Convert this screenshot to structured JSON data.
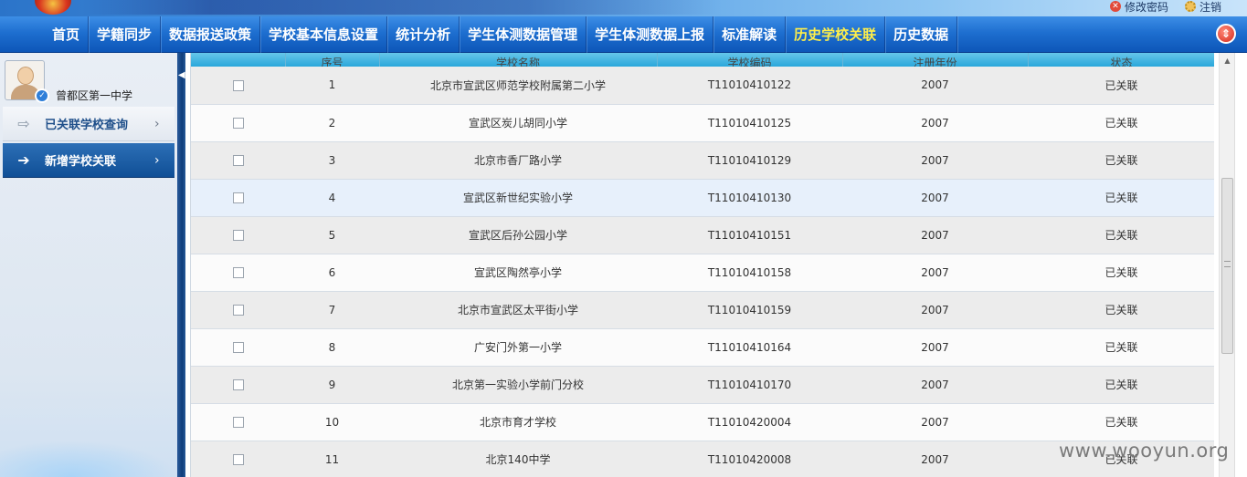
{
  "top_links": {
    "change_password": "修改密码",
    "logout": "注销"
  },
  "nav": {
    "items": [
      {
        "label": "首页"
      },
      {
        "label": "学籍同步"
      },
      {
        "label": "数据报送政策"
      },
      {
        "label": "学校基本信息设置"
      },
      {
        "label": "统计分析"
      },
      {
        "label": "学生体测数据管理"
      },
      {
        "label": "学生体测数据上报"
      },
      {
        "label": "标准解读"
      },
      {
        "label": "历史学校关联",
        "active": true
      },
      {
        "label": "历史数据"
      }
    ]
  },
  "sidebar": {
    "user_name": "曾都区第一中学",
    "items": [
      {
        "label": "已关联学校查询"
      },
      {
        "label": "新增学校关联",
        "active": true
      }
    ]
  },
  "table": {
    "columns": [
      "",
      "序号",
      "学校名称",
      "学校编码",
      "注册年份",
      "状态"
    ],
    "rows": [
      {
        "no": "1",
        "name": "北京市宣武区师范学校附属第二小学",
        "code": "T11010410122",
        "year": "2007",
        "status": "已关联"
      },
      {
        "no": "2",
        "name": "宣武区炭儿胡同小学",
        "code": "T11010410125",
        "year": "2007",
        "status": "已关联"
      },
      {
        "no": "3",
        "name": "北京市香厂路小学",
        "code": "T11010410129",
        "year": "2007",
        "status": "已关联"
      },
      {
        "no": "4",
        "name": "宣武区新世纪实验小学",
        "code": "T11010410130",
        "year": "2007",
        "status": "已关联"
      },
      {
        "no": "5",
        "name": "宣武区后孙公园小学",
        "code": "T11010410151",
        "year": "2007",
        "status": "已关联"
      },
      {
        "no": "6",
        "name": "宣武区陶然亭小学",
        "code": "T11010410158",
        "year": "2007",
        "status": "已关联"
      },
      {
        "no": "7",
        "name": "北京市宣武区太平街小学",
        "code": "T11010410159",
        "year": "2007",
        "status": "已关联"
      },
      {
        "no": "8",
        "name": "广安门外第一小学",
        "code": "T11010410164",
        "year": "2007",
        "status": "已关联"
      },
      {
        "no": "9",
        "name": "北京第一实验小学前门分校",
        "code": "T11010410170",
        "year": "2007",
        "status": "已关联"
      },
      {
        "no": "10",
        "name": "北京市育才学校",
        "code": "T11010420004",
        "year": "2007",
        "status": "已关联"
      },
      {
        "no": "11",
        "name": "北京140中学",
        "code": "T11010420008",
        "year": "2007",
        "status": "已关联"
      }
    ]
  },
  "watermark": "www.wooyun.org",
  "colors": {
    "nav_bg": "#1e6fd0",
    "nav_active": "#ffef4a",
    "table_header": "#2aa7db",
    "sidebar_active": "#104f96"
  }
}
